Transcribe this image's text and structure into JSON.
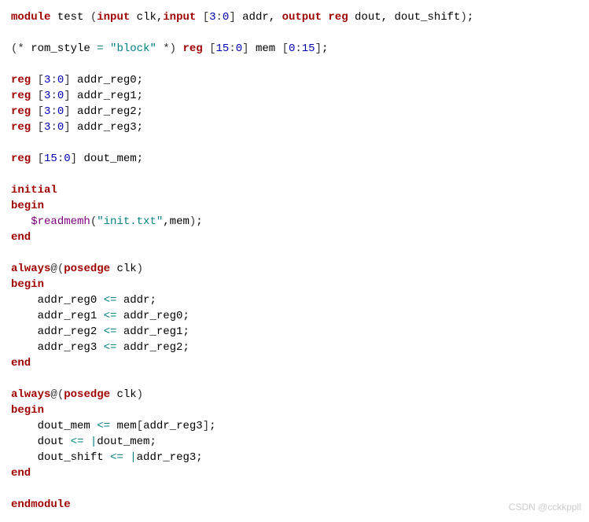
{
  "l1": {
    "kw_module": "module",
    "id_test": " test ",
    "p1": "(",
    "kw_input1": "input",
    "id_clk": " clk",
    "c1": ",",
    "kw_input2": "input",
    "sp": " ",
    "b1": "[",
    "n3": "3",
    "col1": ":",
    "n0": "0",
    "b2": "]",
    "id_addr": " addr",
    "c2": ", ",
    "kw_output": "output",
    "sp2": " ",
    "kw_reg": "reg",
    "id_dout": " dout",
    "c3": ", ",
    "id_ds": "dout_shift",
    "p2": ")",
    "sc": ";"
  },
  "l3": {
    "p1": "(",
    "star1": "* ",
    "id_rs": "rom_style ",
    "eq": "= ",
    "str": "\"block\"",
    "star2": " *",
    "p2": ")",
    "sp": " ",
    "kw_reg": "reg",
    "sp2": " ",
    "b1": "[",
    "n15": "15",
    "col": ":",
    "n0": "0",
    "b2": "]",
    "id_mem": " mem ",
    "b3": "[",
    "n0b": "0",
    "col2": ":",
    "n15b": "15",
    "b4": "]",
    "sc": ";"
  },
  "l5": {
    "kw": "reg",
    "sp": " ",
    "b1": "[",
    "n3": "3",
    "col": ":",
    "n0": "0",
    "b2": "]",
    "id": " addr_reg0",
    "sc": ";"
  },
  "l6": {
    "kw": "reg",
    "sp": " ",
    "b1": "[",
    "n3": "3",
    "col": ":",
    "n0": "0",
    "b2": "]",
    "id": " addr_reg1",
    "sc": ";"
  },
  "l7": {
    "kw": "reg",
    "sp": " ",
    "b1": "[",
    "n3": "3",
    "col": ":",
    "n0": "0",
    "b2": "]",
    "id": " addr_reg2",
    "sc": ";"
  },
  "l8": {
    "kw": "reg",
    "sp": " ",
    "b1": "[",
    "n3": "3",
    "col": ":",
    "n0": "0",
    "b2": "]",
    "id": " addr_reg3",
    "sc": ";"
  },
  "l10": {
    "kw": "reg",
    "sp": " ",
    "b1": "[",
    "n15": "15",
    "col": ":",
    "n0": "0",
    "b2": "]",
    "id": " dout_mem",
    "sc": ";"
  },
  "l12": {
    "kw": "initial"
  },
  "l13": {
    "kw": "begin"
  },
  "l14": {
    "ind": "   ",
    "sys": "$readmemh",
    "p1": "(",
    "str": "\"init.txt\"",
    "c": ",",
    "id": "mem",
    "p2": ")",
    "sc": ";"
  },
  "l15": {
    "kw": "end"
  },
  "l17": {
    "kw_always": "always",
    "at": "@",
    "p1": "(",
    "kw_posedge": "posedge",
    "id": " clk",
    "p2": ")"
  },
  "l18": {
    "kw": "begin"
  },
  "l19": {
    "ind": "    ",
    "lhs": "addr_reg0 ",
    "op": "<=",
    "rhs": " addr",
    "sc": ";"
  },
  "l20": {
    "ind": "    ",
    "lhs": "addr_reg1 ",
    "op": "<=",
    "rhs": " addr_reg0",
    "sc": ";"
  },
  "l21": {
    "ind": "    ",
    "lhs": "addr_reg2 ",
    "op": "<=",
    "rhs": " addr_reg1",
    "sc": ";"
  },
  "l22": {
    "ind": "    ",
    "lhs": "addr_reg3 ",
    "op": "<=",
    "rhs": " addr_reg2",
    "sc": ";"
  },
  "l23": {
    "kw": "end"
  },
  "l25": {
    "kw_always": "always",
    "at": "@",
    "p1": "(",
    "kw_posedge": "posedge",
    "id": " clk",
    "p2": ")"
  },
  "l26": {
    "kw": "begin"
  },
  "l27": {
    "ind": "    ",
    "lhs": "dout_mem ",
    "op": "<=",
    "rhs1": " mem",
    "b1": "[",
    "idx": "addr_reg3",
    "b2": "]",
    "sc": ";"
  },
  "l28": {
    "ind": "    ",
    "lhs": "dout ",
    "op": "<=",
    "sp": " ",
    "bar": "|",
    "rhs": "dout_mem",
    "sc": ";"
  },
  "l29": {
    "ind": "    ",
    "lhs": "dout_shift ",
    "op": "<=",
    "sp": " ",
    "bar": "|",
    "rhs": "addr_reg3",
    "sc": ";"
  },
  "l30": {
    "kw": "end"
  },
  "l32": {
    "kw": "endmodule"
  },
  "watermark": "CSDN @cckkppll",
  "chart_data": {
    "type": "table",
    "title": "Verilog source code",
    "language": "verilog",
    "module_name": "test",
    "ports": [
      {
        "direction": "input",
        "name": "clk"
      },
      {
        "direction": "input",
        "width": "[3:0]",
        "name": "addr"
      },
      {
        "direction": "output",
        "kind": "reg",
        "name": "dout"
      },
      {
        "direction": "output",
        "kind": "reg",
        "name": "dout_shift"
      }
    ],
    "rom_style_attribute": "block",
    "memory": {
      "name": "mem",
      "word_width": "[15:0]",
      "depth": "[0:15]"
    },
    "registers": [
      {
        "name": "addr_reg0",
        "width": "[3:0]"
      },
      {
        "name": "addr_reg1",
        "width": "[3:0]"
      },
      {
        "name": "addr_reg2",
        "width": "[3:0]"
      },
      {
        "name": "addr_reg3",
        "width": "[3:0]"
      },
      {
        "name": "dout_mem",
        "width": "[15:0]"
      }
    ],
    "initial_block": [
      "$readmemh(\"init.txt\",mem);"
    ],
    "always_blocks": [
      {
        "sensitivity": "posedge clk",
        "body": [
          "addr_reg0 <= addr;",
          "addr_reg1 <= addr_reg0;",
          "addr_reg2 <= addr_reg1;",
          "addr_reg3 <= addr_reg2;"
        ]
      },
      {
        "sensitivity": "posedge clk",
        "body": [
          "dout_mem <= mem[addr_reg3];",
          "dout <= |dout_mem;",
          "dout_shift <= |addr_reg3;"
        ]
      }
    ]
  }
}
